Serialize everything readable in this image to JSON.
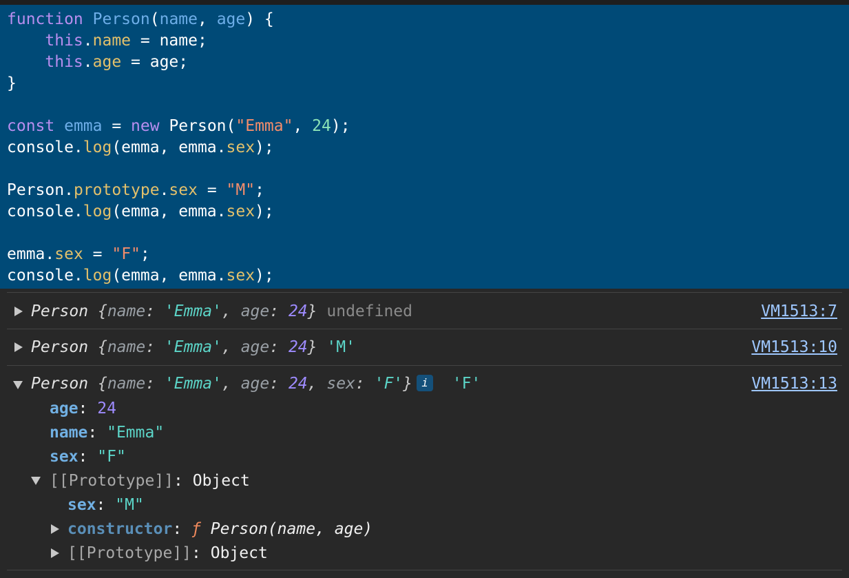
{
  "code": {
    "l1": {
      "kw": "function",
      "fn": "Person",
      "p1": "name",
      "p2": "age",
      "tail": ") {"
    },
    "l2": {
      "this": "this",
      "prop": "name",
      "rhs": " = name;"
    },
    "l3": {
      "this": "this",
      "prop": "age",
      "rhs": " = age;"
    },
    "l4": "}",
    "l6": {
      "kw": "const",
      "var": "emma",
      "eq": " = ",
      "new": "new",
      "call": " Person(",
      "str": "\"Emma\"",
      "comma": ", ",
      "num": "24",
      "tail": ");"
    },
    "log": {
      "obj": "console.",
      "fn": "log",
      "args": "(emma, emma.",
      "prop": "sex",
      "tail": ");"
    },
    "l9": {
      "obj": "Person.",
      "prop1": "prototype",
      "dot": ".",
      "prop2": "sex",
      "eq": " = ",
      "str": "\"M\"",
      "tail": ";"
    },
    "l12": {
      "obj": "emma.",
      "prop": "sex",
      "eq": " = ",
      "str": "\"F\"",
      "tail": ";"
    }
  },
  "console": {
    "entries": [
      {
        "preview": "Person",
        "name_key": "name",
        "name_val": "'Emma'",
        "age_key": "age",
        "age_val": "24",
        "extra": "undefined",
        "source": "VM1513:7"
      },
      {
        "preview": "Person",
        "name_key": "name",
        "name_val": "'Emma'",
        "age_key": "age",
        "age_val": "24",
        "extra": "'M'",
        "source": "VM1513:10"
      },
      {
        "preview": "Person",
        "name_key": "name",
        "name_val": "'Emma'",
        "age_key": "age",
        "age_val": "24",
        "sex_key": "sex",
        "sex_val": "'F'",
        "info": "i",
        "extra": "'F'",
        "source": "VM1513:13"
      }
    ],
    "expanded": {
      "age": {
        "key": "age",
        "val": "24"
      },
      "name": {
        "key": "name",
        "val": "\"Emma\""
      },
      "sex": {
        "key": "sex",
        "val": "\"F\""
      },
      "proto": {
        "label": "[[Prototype]]",
        "val": "Object"
      },
      "proto_sex": {
        "key": "sex",
        "val": "\"M\""
      },
      "constructor": {
        "key": "constructor",
        "f": "ƒ",
        "sig": "Person(name, age)"
      },
      "proto2": {
        "label": "[[Prototype]]",
        "val": "Object"
      }
    }
  }
}
